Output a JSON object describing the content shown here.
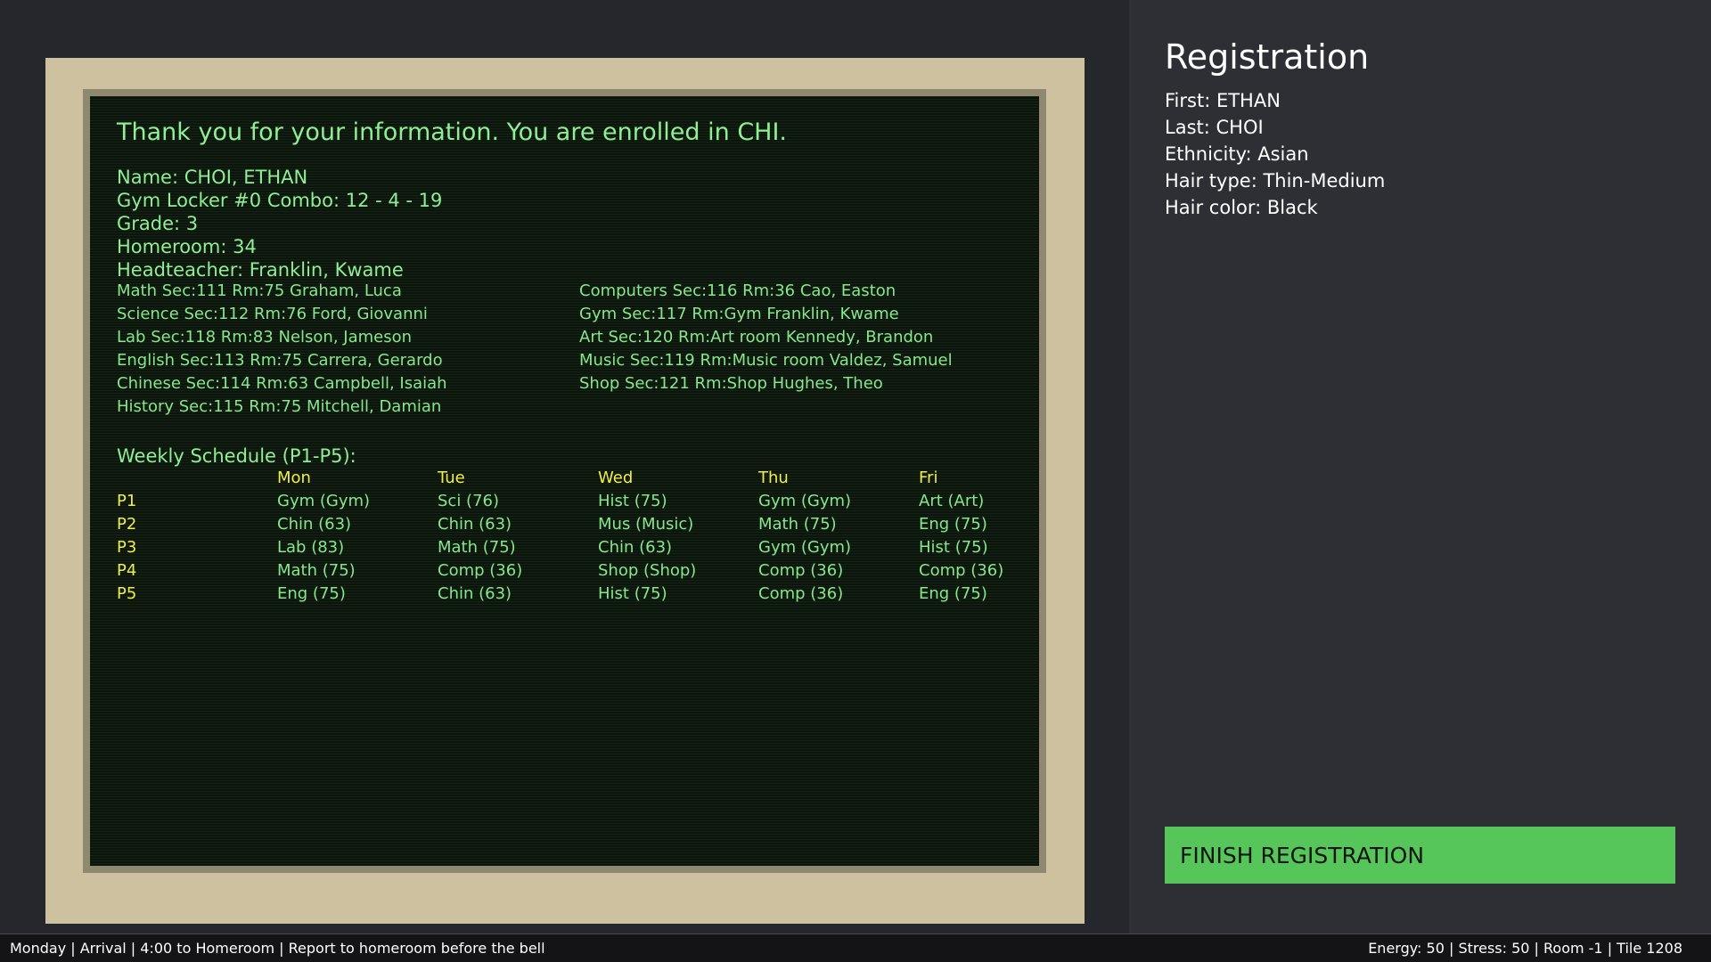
{
  "terminal": {
    "heading": "Thank you for your information. You are enrolled in CHI.",
    "name_line": "Name: CHOI, ETHAN",
    "locker_line": "Gym Locker #0   Combo: 12 - 4 - 19",
    "grade_line": "Grade: 3",
    "homeroom_line": "Homeroom: 34",
    "headteacher_line": "Headteacher: Franklin, Kwame",
    "courses_left": [
      "Math Sec:111 Rm:75 Graham, Luca",
      "Science Sec:112 Rm:76 Ford, Giovanni",
      "Lab Sec:118 Rm:83 Nelson, Jameson",
      "English Sec:113 Rm:75 Carrera, Gerardo",
      "Chinese Sec:114 Rm:63 Campbell, Isaiah",
      "History Sec:115 Rm:75 Mitchell, Damian"
    ],
    "courses_right": [
      "Computers Sec:116 Rm:36 Cao, Easton",
      "Gym Sec:117 Rm:Gym Franklin, Kwame",
      "Art Sec:120 Rm:Art room Kennedy, Brandon",
      "Music Sec:119 Rm:Music room Valdez, Samuel",
      "Shop Sec:121 Rm:Shop Hughes, Theo"
    ],
    "schedule_title": "Weekly Schedule (P1-P5):",
    "days": [
      "Mon",
      "Tue",
      "Wed",
      "Thu",
      "Fri"
    ],
    "periods": [
      {
        "label": "P1",
        "cells": [
          "Gym (Gym)",
          "Sci (76)",
          "Hist (75)",
          "Gym (Gym)",
          "Art (Art)"
        ]
      },
      {
        "label": "P2",
        "cells": [
          "Chin (63)",
          "Chin (63)",
          "Mus (Music)",
          "Math (75)",
          "Eng (75)"
        ]
      },
      {
        "label": "P3",
        "cells": [
          "Lab (83)",
          "Math (75)",
          "Chin (63)",
          "Gym (Gym)",
          "Hist (75)"
        ]
      },
      {
        "label": "P4",
        "cells": [
          "Math (75)",
          "Comp (36)",
          "Shop (Shop)",
          "Comp (36)",
          "Comp (36)"
        ]
      },
      {
        "label": "P5",
        "cells": [
          "Eng (75)",
          "Chin (63)",
          "Hist (75)",
          "Comp (36)",
          "Eng (75)"
        ]
      }
    ]
  },
  "panel": {
    "title": "Registration",
    "lines": [
      "First: ETHAN",
      "Last:  CHOI",
      "Ethnicity: Asian",
      "Hair type: Thin-Medium",
      "Hair color: Black"
    ],
    "finish_label": "FINISH REGISTRATION"
  },
  "status": {
    "left": "Monday | Arrival | 4:00 to Homeroom | Report to homeroom before the bell",
    "right": "Energy: 50 | Stress: 50 | Room -1 | Tile 1208"
  },
  "colors": {
    "terminal_text": "#86e88a",
    "schedule_header": "#f2ee45",
    "finish_button": "#57c65a",
    "bezel": "#cdc19f"
  }
}
